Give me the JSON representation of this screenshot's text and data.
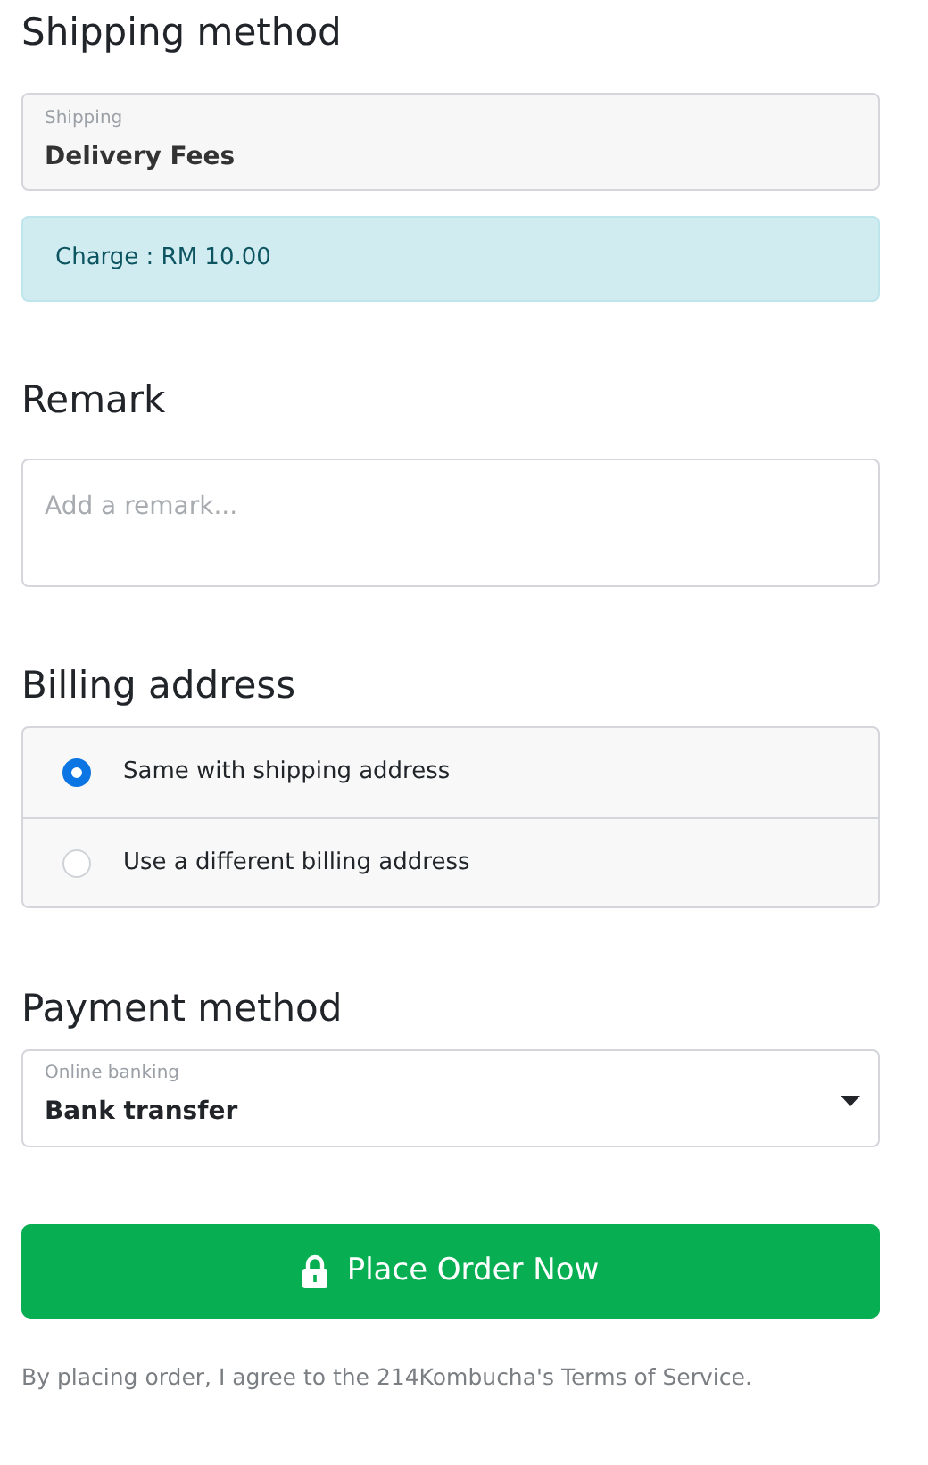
{
  "shipping": {
    "heading": "Shipping method",
    "field_label": "Shipping",
    "value": "Delivery Fees",
    "notice": "Charge : RM 10.00"
  },
  "remark": {
    "heading": "Remark",
    "placeholder": "Add a remark..."
  },
  "billing": {
    "heading": "Billing address",
    "options": [
      {
        "label": "Same with shipping address",
        "selected": true
      },
      {
        "label": "Use a different billing address",
        "selected": false
      }
    ]
  },
  "payment": {
    "heading": "Payment method",
    "field_label": "Online banking",
    "value": "Bank transfer"
  },
  "submit": {
    "label": "Place Order Now"
  },
  "footer": "By placing order, I agree to the 214Kombucha's Terms of Service."
}
